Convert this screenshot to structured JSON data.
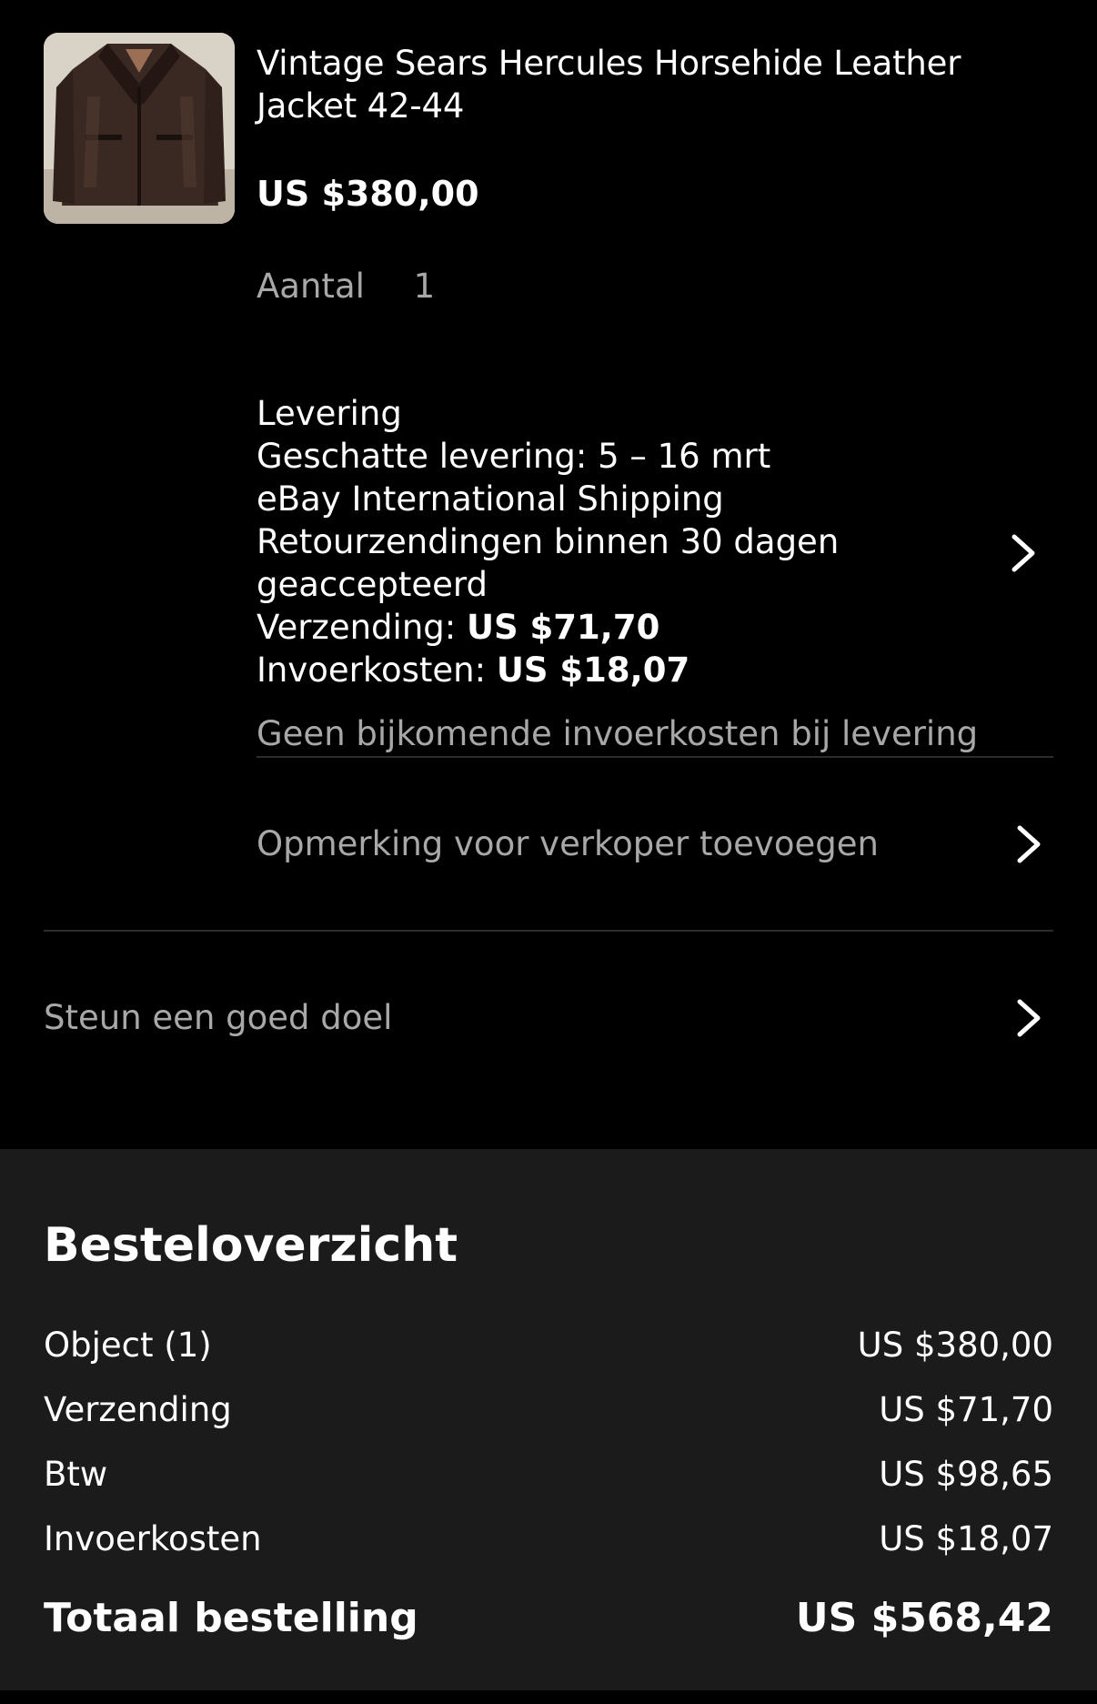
{
  "item": {
    "title": "Vintage Sears Hercules Horsehide Leather Jacket 42-44",
    "price": "US $380,00",
    "quantity_label": "Aantal",
    "quantity_value": "1",
    "image_icon": "leather-jacket-photo"
  },
  "delivery": {
    "heading": "Levering",
    "estimate": "Geschatte levering: 5 – 16 mrt",
    "carrier": "eBay International Shipping",
    "returns": "Retourzendingen binnen 30 dagen geaccepteerd",
    "shipping_label": "Verzending: ",
    "shipping_value": "US $71,70",
    "import_label": "Invoerkosten: ",
    "import_value": "US $18,07",
    "no_extra_import": "Geen bijkomende invoerkosten bij levering",
    "chevron_icon": "chevron-right-icon"
  },
  "note": {
    "label": "Opmerking voor verkoper toevoegen"
  },
  "charity": {
    "label": "Steun een goed doel"
  },
  "summary": {
    "title": "Besteloverzicht",
    "rows": [
      {
        "label": "Object (1)",
        "value": "US $380,00"
      },
      {
        "label": "Verzending",
        "value": "US $71,70"
      },
      {
        "label": "Btw",
        "value": "US $98,65"
      },
      {
        "label": "Invoerkosten",
        "value": "US $18,07"
      }
    ],
    "total_label": "Totaal bestelling",
    "total_value": "US $568,42"
  },
  "colors": {
    "background": "#000000",
    "summary_background": "#1b1b1b",
    "primary_text": "#ffffff",
    "secondary_text": "#a8a8a8",
    "divider": "#2d2d2d"
  }
}
